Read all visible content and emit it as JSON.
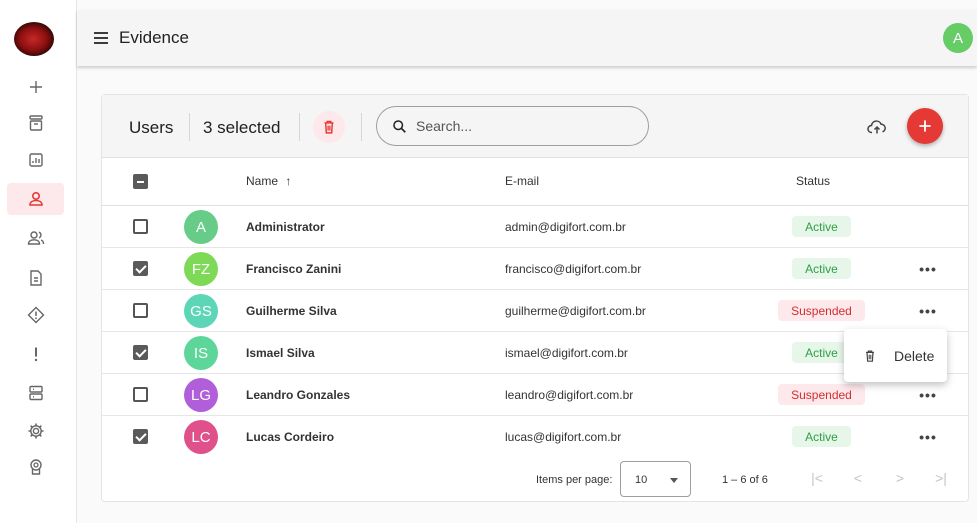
{
  "app": {
    "title": "Evidence",
    "user_initial": "A"
  },
  "nav": [
    {
      "name": "add",
      "active": false
    },
    {
      "name": "archive",
      "active": false
    },
    {
      "name": "reports",
      "active": false
    },
    {
      "name": "users",
      "active": true
    },
    {
      "name": "groups",
      "active": false
    },
    {
      "name": "document",
      "active": false
    },
    {
      "name": "alerts",
      "active": false
    },
    {
      "name": "exclamation",
      "active": false
    },
    {
      "name": "servers",
      "active": false
    },
    {
      "name": "settings",
      "active": false
    },
    {
      "name": "license",
      "active": false
    }
  ],
  "toolbar": {
    "title": "Users",
    "selected_label": "3 selected",
    "search_placeholder": "Search..."
  },
  "table": {
    "columns": {
      "name": "Name",
      "email": "E-mail",
      "status": "Status"
    },
    "sort_indicator": "↑",
    "rows": [
      {
        "initials": "A",
        "name": "Administrator",
        "email": "admin@digifort.com.br",
        "status": "Active",
        "checked": false,
        "avatar_color": "#66cc88",
        "has_menu": false
      },
      {
        "initials": "FZ",
        "name": "Francisco Zanini",
        "email": "francisco@digifort.com.br",
        "status": "Active",
        "checked": true,
        "avatar_color": "#7ed957",
        "has_menu": true
      },
      {
        "initials": "GS",
        "name": "Guilherme Silva",
        "email": "guilherme@digifort.com.br",
        "status": "Suspended",
        "checked": false,
        "avatar_color": "#5dd6b8",
        "has_menu": true
      },
      {
        "initials": "IS",
        "name": "Ismael Silva",
        "email": "ismael@digifort.com.br",
        "status": "Active",
        "checked": true,
        "avatar_color": "#5ed69a",
        "has_menu": false
      },
      {
        "initials": "LG",
        "name": "Leandro Gonzales",
        "email": "leandro@digifort.com.br",
        "status": "Suspended",
        "checked": false,
        "avatar_color": "#b05ed9",
        "has_menu": true
      },
      {
        "initials": "LC",
        "name": "Lucas Cordeiro",
        "email": "lucas@digifort.com.br",
        "status": "Active",
        "checked": true,
        "avatar_color": "#e0508a",
        "has_menu": true
      }
    ]
  },
  "paginator": {
    "items_per_page_label": "Items per page:",
    "page_size": "10",
    "range_label": "1 – 6 of 6"
  },
  "context_menu": {
    "delete_label": "Delete"
  },
  "colors": {
    "accent": "#e53935",
    "active_nav_bg": "#fde8ec",
    "active_badge": "#2f9e44",
    "suspended_badge": "#d32f2f"
  }
}
